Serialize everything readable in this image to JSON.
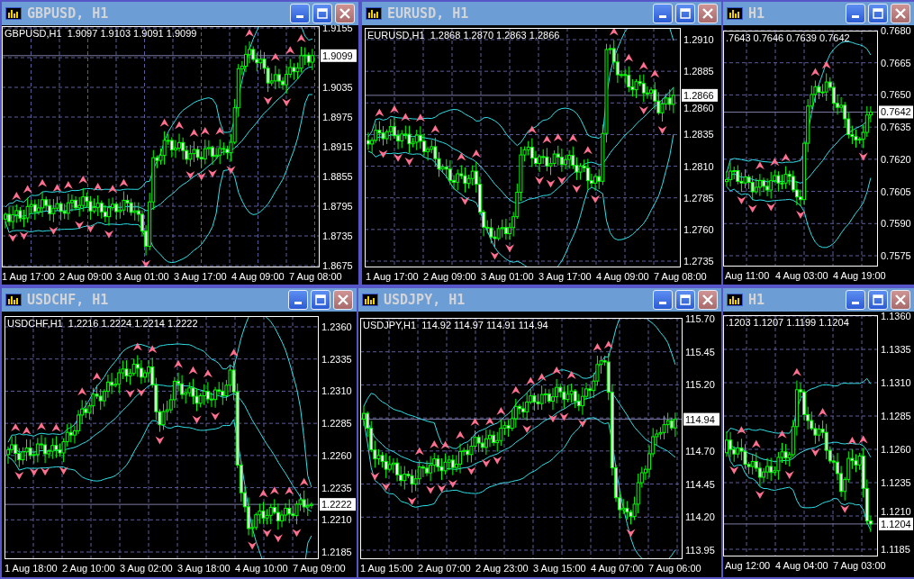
{
  "windows": [
    {
      "title": "GBPUSD, H1",
      "legend": "GBPUSD,H1  1.9097 1.9103 1.9091 1.9099",
      "current_price": "1.9099",
      "price_ticks": [
        "1.9155",
        "1.9035",
        "1.8975",
        "1.8915",
        "1.8855",
        "1.8795",
        "1.8735",
        "1.8675"
      ],
      "time_ticks": [
        "1 Aug 17:00",
        "2 Aug 09:00",
        "3 Aug 01:00",
        "3 Aug 17:00",
        "4 Aug 09:00",
        "7 Aug 08:00"
      ]
    },
    {
      "title": "EURUSD, H1",
      "legend": "EURUSD,H1  1.2868 1.2870 1.2863 1.2866",
      "current_price": "1.2866",
      "price_ticks": [
        "1.2910",
        "1.2885",
        "1.2860",
        "1.2835",
        "1.2810",
        "1.2785",
        "1.2760",
        "1.2735"
      ],
      "time_ticks": [
        "1 Aug 17:00",
        "2 Aug 09:00",
        "3 Aug 01:00",
        "3 Aug 17:00",
        "4 Aug 09:00",
        "7 Aug 08:00"
      ]
    },
    {
      "title": "H1",
      "legend": ".7643 0.7646 0.7639 0.7642",
      "current_price": "0.7642",
      "price_ticks": [
        "0.7680",
        "0.7665",
        "0.7650",
        "0.7635",
        "0.7620",
        "0.7605",
        "0.7590",
        "0.7575"
      ],
      "time_ticks": [
        "Aug 11:00",
        "4 Aug 03:00",
        "4 Aug 19:00"
      ]
    },
    {
      "title": "USDCHF, H1",
      "legend": "USDCHF,H1  1.2216 1.2224 1.2214 1.2222",
      "current_price": "1.2222",
      "price_ticks": [
        "1.2360",
        "1.2335",
        "1.2310",
        "1.2285",
        "1.2260",
        "1.2235",
        "1.2210",
        "1.2185"
      ],
      "time_ticks": [
        "1 Aug 18:00",
        "2 Aug 10:00",
        "3 Aug 02:00",
        "3 Aug 18:00",
        "4 Aug 10:00",
        "7 Aug 09:00"
      ]
    },
    {
      "title": "USDJPY, H1",
      "legend": "USDJPY,H1  114.92 114.97 114.91 114.94",
      "current_price": "114.94",
      "price_ticks": [
        "115.70",
        "115.45",
        "115.20",
        "114.70",
        "114.45",
        "114.20",
        "113.95"
      ],
      "time_ticks": [
        "1 Aug 15:00",
        "2 Aug 07:00",
        "2 Aug 23:00",
        "3 Aug 15:00",
        "4 Aug 07:00",
        "7 Aug 06:00"
      ]
    },
    {
      "title": "H1",
      "legend": ".1203 1.1207 1.1199 1.1204",
      "current_price": "1.1204",
      "price_ticks": [
        "1.1360",
        "1.1335",
        "1.1310",
        "1.1285",
        "1.1260",
        "1.1235",
        "1.1210",
        "1.1185"
      ],
      "time_ticks": [
        "Aug 12:00",
        "4 Aug 04:00",
        "7 Aug 03:00"
      ]
    }
  ]
}
